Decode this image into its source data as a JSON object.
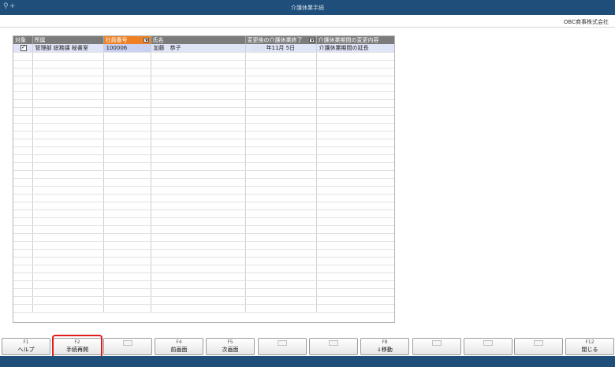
{
  "window": {
    "title": "介護休業手続"
  },
  "header": {
    "company": "OBC商事株式会社"
  },
  "grid": {
    "columns": [
      "対象",
      "所属",
      "社員番号",
      "氏名",
      "変更後の介護休業終了",
      "介護休業期間の変更内容"
    ],
    "rows": [
      {
        "checked": true,
        "dept": "管理部 総務課 秘書室",
        "emp_no": "100006",
        "name": "加藤　恭子",
        "end_date": "年11月 5日",
        "change": "介護休業期間の延長"
      }
    ],
    "empty_rows": 33
  },
  "fkeys": [
    {
      "key": "F1",
      "label": "ヘルプ"
    },
    {
      "key": "F2",
      "label": "手続再開"
    },
    {
      "key": "",
      "label": ""
    },
    {
      "key": "F4",
      "label": "前画面"
    },
    {
      "key": "F5",
      "label": "次画面"
    },
    {
      "key": "",
      "label": ""
    },
    {
      "key": "",
      "label": ""
    },
    {
      "key": "F8",
      "label": "↓移動"
    },
    {
      "key": "",
      "label": ""
    },
    {
      "key": "",
      "label": ""
    },
    {
      "key": "",
      "label": ""
    },
    {
      "key": "F12",
      "label": "閉じる"
    }
  ],
  "colors": {
    "titlebar": "#1e4e79",
    "sort_header": "#ee8125",
    "highlight": "#e11c1c"
  }
}
